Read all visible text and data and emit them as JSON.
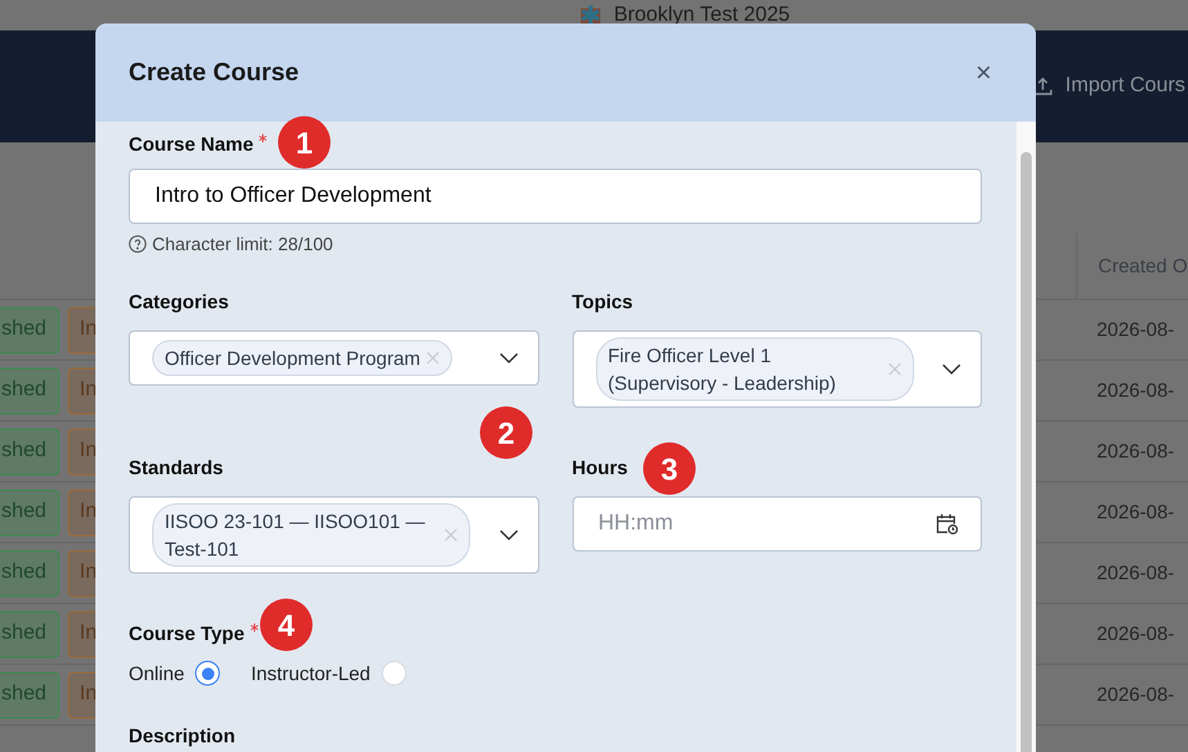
{
  "app_bar": {
    "org_name": "Brooklyn Test 2025"
  },
  "toolbar": {
    "import_button": "Import Cours"
  },
  "table": {
    "columns": [
      "Created O"
    ],
    "rows": [
      {
        "status": "shed",
        "type": "In",
        "created": "2026-08-"
      },
      {
        "status": "shed",
        "type": "In",
        "created": "2026-08-"
      },
      {
        "status": "shed",
        "type": "In",
        "created": "2026-08-"
      },
      {
        "status": "shed",
        "type": "In",
        "created": "2026-08-"
      },
      {
        "status": "shed",
        "type": "In",
        "created": "2026-08-"
      },
      {
        "status": "shed",
        "type": "In",
        "created": "2026-08-"
      },
      {
        "status": "shed",
        "type": "In",
        "created": "2026-08-"
      }
    ]
  },
  "dialog": {
    "title": "Create Course",
    "close": "×",
    "course_name": {
      "label": "Course Name",
      "required": true,
      "value": "Intro to Officer Development",
      "hint": "Character limit: 28/100"
    },
    "categories": {
      "label": "Categories",
      "chips": [
        "Officer Development Program"
      ]
    },
    "topics": {
      "label": "Topics",
      "chips": [
        "Fire Officer Level 1 (Supervisory - Leadership)"
      ]
    },
    "standards": {
      "label": "Standards",
      "chips": [
        "IISOO 23-101 — IISOO101 — Test-101"
      ]
    },
    "hours": {
      "label": "Hours",
      "placeholder": "HH:mm"
    },
    "course_type": {
      "label": "Course Type",
      "required": true,
      "options": [
        {
          "label": "Online",
          "selected": true
        },
        {
          "label": "Instructor-Led",
          "selected": false
        }
      ]
    },
    "description": {
      "label": "Description"
    }
  },
  "annotations": [
    "1",
    "2",
    "3",
    "4"
  ]
}
